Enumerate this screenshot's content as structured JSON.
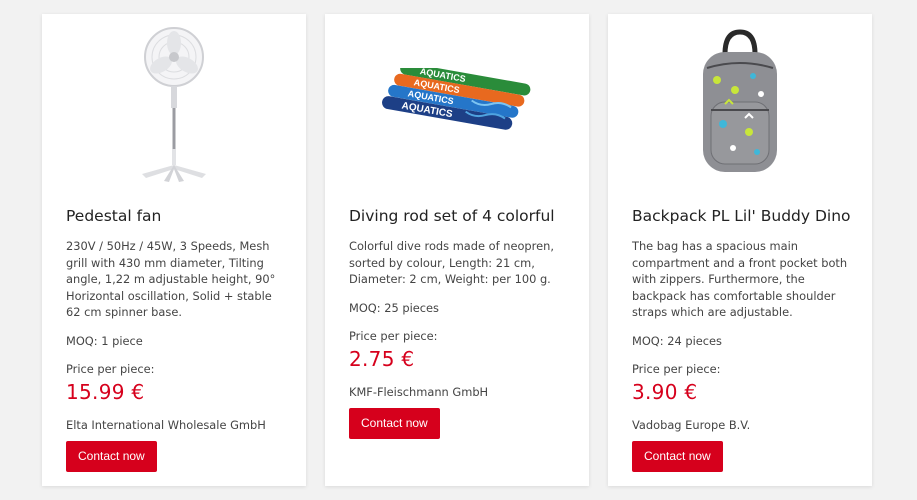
{
  "products": [
    {
      "title": "Pedestal fan",
      "image_icon": "pedestal-fan-image",
      "description": "230V / 50Hz / 45W, 3 Speeds, Mesh grill with 430 mm diameter, Tilting angle, 1,22 m adjustable height, 90° Horizontal oscillation, Solid + stable 62 cm spinner base.",
      "moq": "MOQ: 1 piece",
      "price_label": "Price per piece:",
      "price": "15.99 €",
      "supplier": "Elta International Wholesale GmbH",
      "button_label": "Contact now"
    },
    {
      "title": "Diving rod set of 4 colorful",
      "image_icon": "diving-rods-image",
      "image_text": "AQUATICS",
      "description": "Colorful dive rods made of neopren, sorted by colour, Length: 21 cm, Diameter: 2 cm, Weight: per 100 g.",
      "moq": "MOQ: 25 pieces",
      "price_label": "Price per piece:",
      "price": "2.75 €",
      "supplier": "KMF-Fleischmann GmbH",
      "button_label": "Contact now"
    },
    {
      "title": "Backpack PL Lil' Buddy Dino",
      "image_icon": "backpack-image",
      "description": "The bag has a spacious main compartment and a front pocket both with zippers. Furthermore, the backpack has comfortable shoulder straps which are adjustable.",
      "moq": "MOQ: 24 pieces",
      "price_label": "Price per piece:",
      "price": "3.90 €",
      "supplier": "Vadobag Europe B.V.",
      "button_label": "Contact now"
    }
  ],
  "colors": {
    "accent": "#d6001c",
    "background": "#f2f2f2",
    "card": "#ffffff"
  }
}
